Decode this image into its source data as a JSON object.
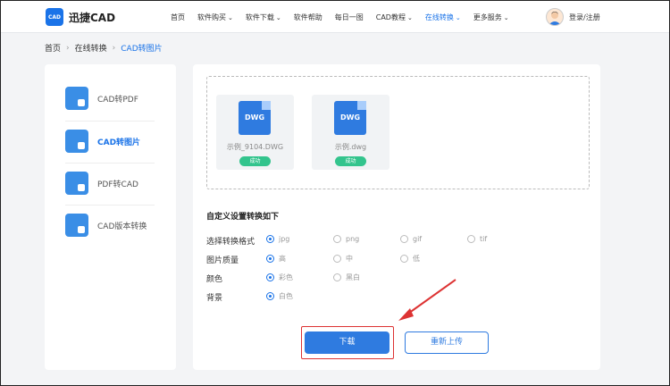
{
  "header": {
    "logo_badge": "CAD",
    "logo_text": "迅捷CAD",
    "nav": [
      {
        "label": "首页",
        "dropdown": false
      },
      {
        "label": "软件购买",
        "dropdown": true
      },
      {
        "label": "软件下载",
        "dropdown": true
      },
      {
        "label": "软件帮助",
        "dropdown": false
      },
      {
        "label": "每日一图",
        "dropdown": false
      },
      {
        "label": "CAD教程",
        "dropdown": true
      },
      {
        "label": "在线转换",
        "dropdown": true,
        "active": true
      },
      {
        "label": "更多服务",
        "dropdown": true
      }
    ],
    "login": "登录/注册"
  },
  "breadcrumb": [
    "首页",
    "在线转换",
    "CAD转图片"
  ],
  "sidebar": {
    "items": [
      {
        "label": "CAD转PDF",
        "icon": "cad-to-pdf-icon"
      },
      {
        "label": "CAD转图片",
        "icon": "cad-to-image-icon",
        "active": true
      },
      {
        "label": "PDF转CAD",
        "icon": "pdf-to-cad-icon"
      },
      {
        "label": "CAD版本转换",
        "icon": "cad-version-icon"
      }
    ]
  },
  "files": [
    {
      "badge": "DWG",
      "name": "示例_9104.DWG",
      "status": "成功"
    },
    {
      "badge": "DWG",
      "name": "示例.dwg",
      "status": "成功"
    }
  ],
  "settings": {
    "title": "自定义设置转换如下",
    "rows": [
      {
        "label": "选择转换格式",
        "options": [
          "jpg",
          "png",
          "gif",
          "tif"
        ],
        "selected": "jpg"
      },
      {
        "label": "图片质量",
        "options": [
          "高",
          "中",
          "低"
        ],
        "selected": "高"
      },
      {
        "label": "颜色",
        "options": [
          "彩色",
          "黑白"
        ],
        "selected": "彩色"
      },
      {
        "label": "背景",
        "options": [
          "白色"
        ],
        "selected": "白色"
      }
    ]
  },
  "buttons": {
    "download": "下载",
    "reupload": "重新上传"
  },
  "colors": {
    "accent": "#1a73e8",
    "success": "#33c48d",
    "highlight": "#d33333"
  }
}
